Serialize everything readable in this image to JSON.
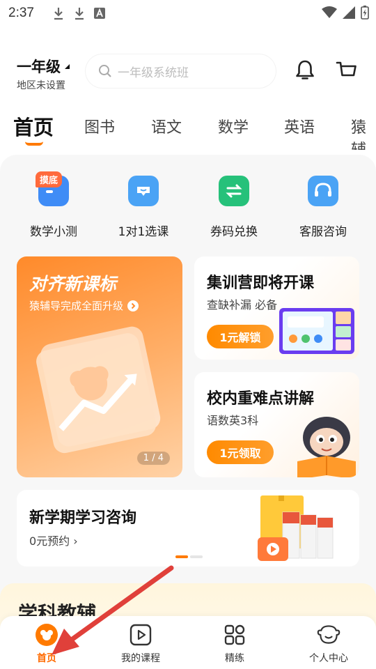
{
  "status_bar": {
    "time": "2:37"
  },
  "header": {
    "grade": "一年级",
    "region": "地区未设置",
    "search_placeholder": "一年级系统班"
  },
  "tabs": [
    "首页",
    "图书",
    "语文",
    "数学",
    "英语",
    "猿辅"
  ],
  "quick_actions": [
    {
      "label": "数学小测",
      "badge": "摸底",
      "icon": "quiz-icon",
      "color": "#3f8cf6"
    },
    {
      "label": "1对1选课",
      "badge": "",
      "icon": "chat-icon",
      "color": "#4aa3f5"
    },
    {
      "label": "券码兑换",
      "badge": "",
      "icon": "exchange-icon",
      "color": "#26c17a"
    },
    {
      "label": "客服咨询",
      "badge": "",
      "icon": "headset-icon",
      "color": "#4aa3f5"
    }
  ],
  "banner": {
    "title": "对齐新课标",
    "subtitle": "猿辅导完成全面升级",
    "page_current": "1",
    "page_total": "4"
  },
  "cards": {
    "camp": {
      "title": "集训营即将开课",
      "subtitle": "查缺补漏 必备",
      "button": "1元解锁"
    },
    "school": {
      "title": "校内重难点讲解",
      "subtitle": "语数英3科",
      "button": "1元领取"
    }
  },
  "consult": {
    "title": "新学期学习咨询",
    "subtitle": "0元预约 ›"
  },
  "subject_section": {
    "title": "学科教辅"
  },
  "bottom_nav": [
    {
      "label": "首页",
      "icon": "home-icon",
      "active": true
    },
    {
      "label": "我的课程",
      "icon": "play-icon",
      "active": false
    },
    {
      "label": "精练",
      "icon": "grid-icon",
      "active": false
    },
    {
      "label": "个人中心",
      "icon": "profile-icon",
      "active": false
    }
  ],
  "colors": {
    "accent": "#ff7a00",
    "annotation_arrow": "#e0403a"
  }
}
